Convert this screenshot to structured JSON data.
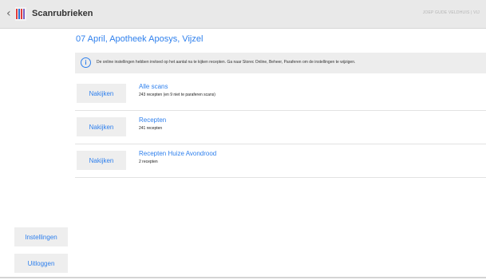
{
  "header": {
    "title": "Scanrubrieken",
    "user_meta": "JOEP GUDE VELDHUIS | VIJ"
  },
  "page_title": "07 April, Apotheek Aposys, Vijzel",
  "info": {
    "text": "De online instellingen hebben invloed op het aantal na te kijken recepten. Ga naar Storec Online, Beheer, Paraferen om de instellingen te wijzigen."
  },
  "items": [
    {
      "button": "Nakijken",
      "title": "Alle scans",
      "subtitle": "243 recepten (en 9 niet te paraferen scans)"
    },
    {
      "button": "Nakijken",
      "title": "Recepten",
      "subtitle": "241 recepten"
    },
    {
      "button": "Nakijken",
      "title": "Recepten Huize Avondrood",
      "subtitle": "2 recepten"
    }
  ],
  "sidebar": {
    "settings_label": "Instellingen",
    "logout_label": "Uitloggen"
  },
  "colors": {
    "accent": "#2f80ed",
    "banner_bg": "#ededed",
    "button_bg": "#eeeeee"
  },
  "icons": {
    "back": "chevron-left-icon",
    "logo": "app-logo-icon",
    "info": "info-icon"
  }
}
